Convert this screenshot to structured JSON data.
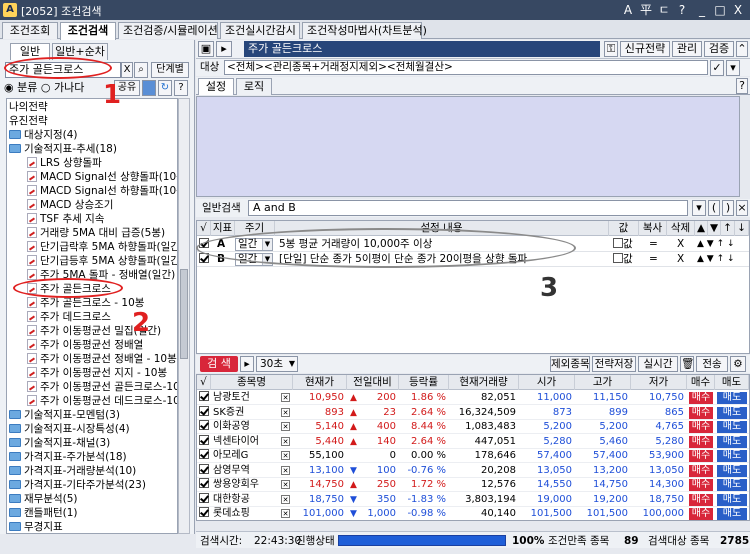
{
  "window": {
    "title": "[2052] 조건검색",
    "buttons": [
      "A",
      "平",
      "ㄷ",
      "?",
      "_",
      "□",
      "X"
    ]
  },
  "top_tabs": [
    "조건조회",
    "조건검색",
    "조건검증/시뮬레이션",
    "조건실시간감시",
    "조건작성마법사(차트분석)"
  ],
  "left": {
    "tabs": [
      "일반",
      "일반+순차"
    ],
    "search_value": "주가 골든크로스",
    "clear_label": "X",
    "step_label": "단계별",
    "radio_label": "분류",
    "sort_label": "가나다",
    "share_label": "공유",
    "tree": [
      "나의전략",
      "유진전략",
      "대상지정(4)",
      "기술적지표-추세(18)",
      "LRS 상향돌파",
      "MACD Signal선 상향돌파(10봉",
      "MACD Signal선 하향돌파(10봉",
      "MACD 상승조기",
      "TSF 추세 지속",
      "거래량 5MA 대비 급증(5봉)",
      "단기급락후 5MA 하향돌파(일간",
      "단기급등후 5MA 상향돌파(일간",
      "주가 5MA 돌파 - 정배열(일간)",
      "주가 골든크로스",
      "주가 골든크로스 - 10봉",
      "주가 데드크로스",
      "주가 이동평균선 밀집(일간)",
      "주가 이동평균선 정배열",
      "주가 이동평균선 정배열 - 10봉",
      "주가 이동평균선 지지 - 10봉",
      "주가 이동평균선 골든크로스-10",
      "주가 이동평균선 데드크로스-10",
      "기술적지표-모멘텀(3)",
      "기술적지표-시장특성(4)",
      "기술적지표-채널(3)",
      "가격지표-주가분석(18)",
      "가격지표-거래량분석(10)",
      "가격지표-기타주가분석(23)",
      "재무분석(5)",
      "캔들패턴(1)",
      "무경지표"
    ]
  },
  "right": {
    "condition_name": "주가 골든크로스",
    "header_buttons": [
      "신규전략",
      "관리",
      "검증"
    ],
    "target_label": "대상",
    "target_value": "<전체><관리종목+거래정지제외><전체월결산>",
    "sub_tabs": [
      "설정",
      "로직"
    ],
    "general_search_label": "일반검색",
    "general_search_value": "A and B",
    "cond_headers": [
      "√",
      "지표",
      "주기",
      "설정 내용",
      "값",
      "복사",
      "삭제",
      "▲",
      "▼",
      "↑",
      "↓"
    ],
    "conditions": [
      {
        "id": "A",
        "period": "일간",
        "text": "5봉 평균 거래량이 10,000주 이상",
        "value": "값",
        "copy": "=",
        "del": "X"
      },
      {
        "id": "B",
        "period": "일간",
        "text": "[단일] 단순 종가 5이평이 단순 종가 20이평을 상향 돌파",
        "value": "값",
        "copy": "=",
        "del": "X"
      }
    ],
    "search_button": "검 색",
    "interval_value": "30초",
    "strip_buttons": [
      "제외종목",
      "전략저장",
      "실시간",
      "전송"
    ],
    "result_headers": [
      "√",
      "종목명",
      "현재가",
      "전일대비",
      "등락률",
      "현재거래량",
      "시가",
      "고가",
      "저가",
      "매수",
      "매도"
    ],
    "results": [
      {
        "name": "남광토건",
        "price": "10,950",
        "dir": "up",
        "chg": "200",
        "rate": "1.86 %",
        "vol": "82,051",
        "open": "11,000",
        "high": "11,150",
        "low": "10,750"
      },
      {
        "name": "SK증권",
        "price": "893",
        "dir": "up",
        "chg": "23",
        "rate": "2.64 %",
        "vol": "16,324,509",
        "open": "873",
        "high": "899",
        "low": "865"
      },
      {
        "name": "이화공영",
        "price": "5,140",
        "dir": "up",
        "chg": "400",
        "rate": "8.44 %",
        "vol": "1,083,483",
        "open": "5,200",
        "high": "5,200",
        "low": "4,765"
      },
      {
        "name": "넥센타이어",
        "price": "5,440",
        "dir": "up",
        "chg": "140",
        "rate": "2.64 %",
        "vol": "447,051",
        "open": "5,280",
        "high": "5,460",
        "low": "5,280"
      },
      {
        "name": "아모레G",
        "price": "55,100",
        "dir": "flat",
        "chg": "0",
        "rate": "0.00 %",
        "vol": "178,646",
        "open": "57,400",
        "high": "57,400",
        "low": "53,900"
      },
      {
        "name": "삼영무역",
        "price": "13,100",
        "dir": "down",
        "chg": "100",
        "rate": "-0.76 %",
        "vol": "20,208",
        "open": "13,050",
        "high": "13,200",
        "low": "13,050"
      },
      {
        "name": "쌍용양회우",
        "price": "14,750",
        "dir": "up",
        "chg": "250",
        "rate": "1.72 %",
        "vol": "12,576",
        "open": "14,550",
        "high": "14,750",
        "low": "14,300"
      },
      {
        "name": "대한항공",
        "price": "18,750",
        "dir": "down",
        "chg": "350",
        "rate": "-1.83 %",
        "vol": "3,803,194",
        "open": "19,000",
        "high": "19,200",
        "low": "18,750"
      },
      {
        "name": "롯데쇼핑",
        "price": "101,000",
        "dir": "down",
        "chg": "1,000",
        "rate": "-0.98 %",
        "vol": "40,140",
        "open": "101,500",
        "high": "101,500",
        "low": "100,000"
      }
    ],
    "buy_label": "매수",
    "sell_label": "매도",
    "status": {
      "time_label": "검색시간:",
      "time": "22:43:30",
      "state_label": "진행상태",
      "percent": "100%",
      "progress_fraction": 1.0,
      "match_label": "조건만족 종목",
      "match_count": "89",
      "target_label": "검색대상 종목",
      "target_count": "2785"
    }
  },
  "annotations": {
    "one": "1",
    "two": "2",
    "three": "3"
  },
  "colors": {
    "title_bar": "#374862",
    "condition_name_bg": "#27467a",
    "search_btn": "#d8263a",
    "annot": "#e02020",
    "up": "#d21a1a",
    "down": "#1f4fd8"
  }
}
